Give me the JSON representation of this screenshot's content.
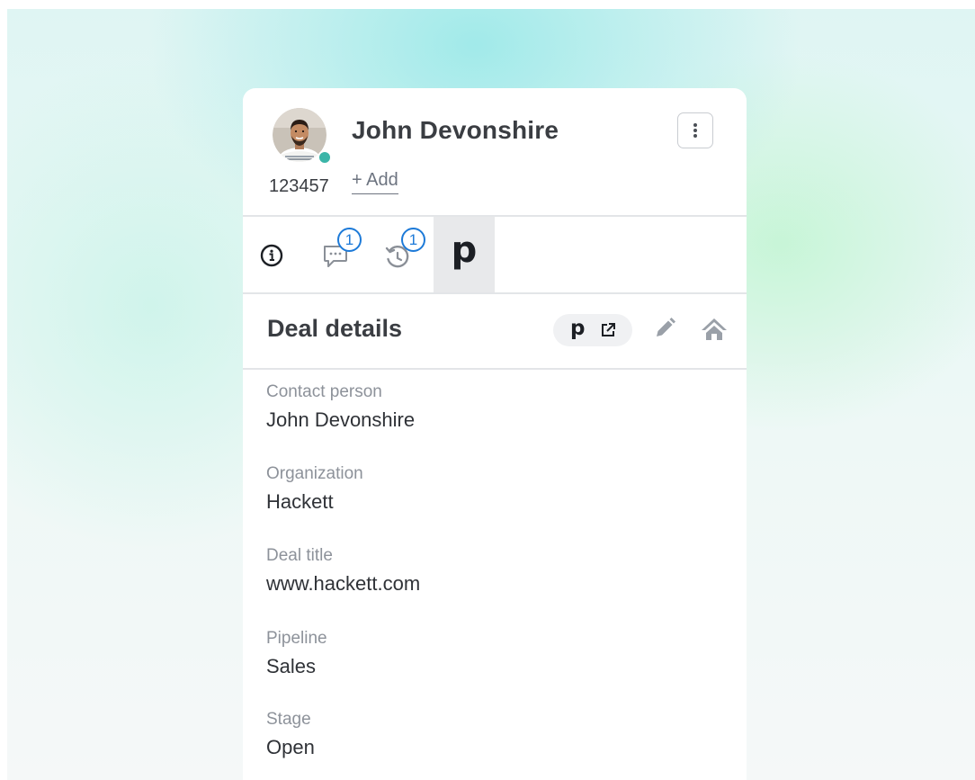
{
  "contact": {
    "name": "John Devonshire",
    "id": "123457",
    "add_label": "+ Add",
    "status": "online",
    "status_color": "#3bb5a8"
  },
  "header": {
    "menu_icon": "kebab-menu-icon"
  },
  "tabs": [
    {
      "name": "info",
      "icon": "info-icon",
      "badge": null
    },
    {
      "name": "notes",
      "icon": "chat-bubble-icon",
      "badge": "1"
    },
    {
      "name": "history",
      "icon": "history-icon",
      "badge": "1"
    },
    {
      "name": "pipedrive",
      "icon": "pipedrive-logo",
      "label": "p",
      "active": true
    }
  ],
  "section": {
    "title": "Deal details",
    "chip_label": "p",
    "actions": [
      "external-link-icon",
      "pencil-icon",
      "home-icon"
    ]
  },
  "fields": [
    {
      "label": "Contact person",
      "value": "John Devonshire"
    },
    {
      "label": "Organization",
      "value": "Hackett"
    },
    {
      "label": "Deal title",
      "value": "www.hackett.com"
    },
    {
      "label": "Pipeline",
      "value": "Sales"
    },
    {
      "label": "Stage",
      "value": "Open"
    }
  ],
  "colors": {
    "accent_blue": "#1d7ad8",
    "active_tab_bg": "#e8e9eb",
    "text_primary": "#3a3d42",
    "text_muted": "#8d929a"
  }
}
